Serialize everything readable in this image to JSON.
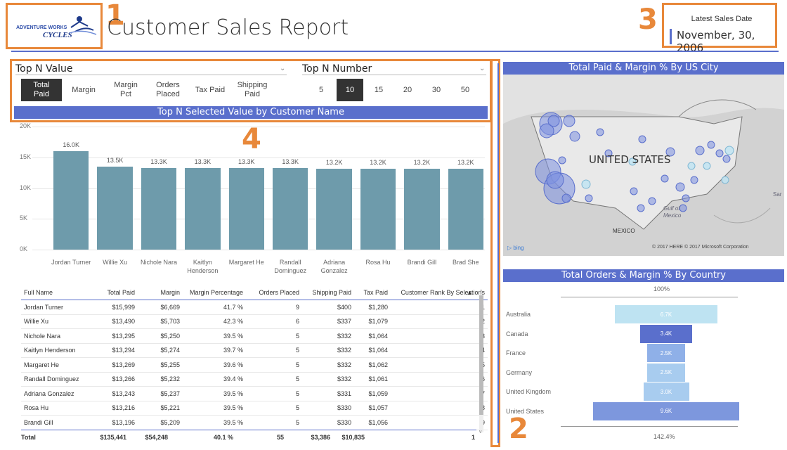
{
  "header": {
    "title": "Customer Sales Report",
    "logo_text_top": "ADVENTURE WORKS",
    "logo_text_bottom": "CYCLES",
    "latest_label": "Latest Sales Date",
    "latest_value": "November, 30, 2006"
  },
  "callouts": [
    "1",
    "2",
    "3",
    "4"
  ],
  "slicers": {
    "top_n_value": {
      "title": "Top N Value",
      "options": [
        "Total\nPaid",
        "Margin",
        "Margin\nPct",
        "Orders\nPlaced",
        "Tax Paid",
        "Shipping\nPaid"
      ],
      "selected": "Total Paid"
    },
    "top_n_number": {
      "title": "Top N Number",
      "options": [
        "5",
        "10",
        "15",
        "20",
        "30",
        "50"
      ],
      "selected": "10"
    }
  },
  "bar_chart": {
    "banner": "Top N Selected Value by Customer Name"
  },
  "chart_data": [
    {
      "type": "bar",
      "title": "Top N Selected Value by Customer Name",
      "categories": [
        "Jordan Turner",
        "Willie Xu",
        "Nichole Nara",
        "Kaitlyn Henderson",
        "Margaret He",
        "Randall Dominguez",
        "Adriana Gonzalez",
        "Rosa Hu",
        "Brandi Gill",
        "Brad She"
      ],
      "values": [
        16.0,
        13.5,
        13.3,
        13.3,
        13.3,
        13.3,
        13.2,
        13.2,
        13.2,
        13.2
      ],
      "data_labels": [
        "16.0K",
        "13.5K",
        "13.3K",
        "13.3K",
        "13.3K",
        "13.3K",
        "13.2K",
        "13.2K",
        "13.2K",
        "13.2K"
      ],
      "y_ticks": [
        "20K",
        "15K",
        "10K",
        "5K",
        "0K"
      ],
      "ylim": [
        0,
        20
      ],
      "color": "#6E9BAB"
    },
    {
      "type": "bar",
      "title": "Total Orders & Margin % By Country",
      "categories": [
        "Australia",
        "Canada",
        "France",
        "Germany",
        "United Kingdom",
        "United States"
      ],
      "values": [
        6.7,
        3.4,
        2.5,
        2.5,
        3.0,
        9.6
      ],
      "data_labels": [
        "6.7K",
        "3.4K",
        "2.5K",
        "2.5K",
        "3.0K",
        "9.6K"
      ],
      "top_label": "100%",
      "bottom_label": "142.4%",
      "colors": [
        "#BEE3F2",
        "#5A6FCC",
        "#8FB0E8",
        "#A8CCEF",
        "#A8CCEF",
        "#7D97DD"
      ]
    }
  ],
  "table": {
    "columns": [
      "Full Name",
      "Total Paid",
      "Margin",
      "Margin Percentage",
      "Orders Placed",
      "Shipping Paid",
      "Tax Paid",
      "Customer Rank By Selections"
    ],
    "rows": [
      [
        "Jordan Turner",
        "$15,999",
        "$6,669",
        "41.7 %",
        "9",
        "$400",
        "$1,280",
        "1"
      ],
      [
        "Willie Xu",
        "$13,490",
        "$5,703",
        "42.3 %",
        "6",
        "$337",
        "$1,079",
        "2"
      ],
      [
        "Nichole Nara",
        "$13,295",
        "$5,250",
        "39.5 %",
        "5",
        "$332",
        "$1,064",
        "3"
      ],
      [
        "Kaitlyn Henderson",
        "$13,294",
        "$5,274",
        "39.7 %",
        "5",
        "$332",
        "$1,064",
        "4"
      ],
      [
        "Margaret He",
        "$13,269",
        "$5,255",
        "39.6 %",
        "5",
        "$332",
        "$1,062",
        "5"
      ],
      [
        "Randall Dominguez",
        "$13,266",
        "$5,232",
        "39.4 %",
        "5",
        "$332",
        "$1,061",
        "6"
      ],
      [
        "Adriana Gonzalez",
        "$13,243",
        "$5,237",
        "39.5 %",
        "5",
        "$331",
        "$1,059",
        "7"
      ],
      [
        "Rosa Hu",
        "$13,216",
        "$5,221",
        "39.5 %",
        "5",
        "$330",
        "$1,057",
        "8"
      ],
      [
        "Brandi Gill",
        "$13,196",
        "$5,209",
        "39.5 %",
        "5",
        "$330",
        "$1,056",
        "9"
      ]
    ],
    "total": [
      "Total",
      "$135,441",
      "$54,248",
      "40.1 %",
      "55",
      "$3,386",
      "$10,835",
      "1"
    ]
  },
  "map_panel": {
    "title": "Total Paid & Margin % By US City",
    "country_label": "UNITED STATES",
    "mexico_label": "MEXICO",
    "gulf_label": "Gulf of Mexico",
    "sar_label": "Sar",
    "bing": "bing",
    "copyright": "© 2017 HERE   © 2017 Microsoft Corporation"
  },
  "country_panel": {
    "title": "Total Orders & Margin % By Country"
  }
}
